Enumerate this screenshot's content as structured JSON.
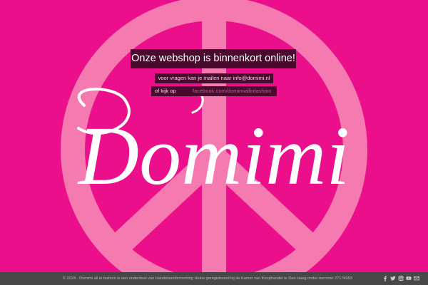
{
  "colors": {
    "background": "#ec0f8c",
    "peace_symbol": "#f47ab0",
    "banner_background": "#4a0a2d",
    "footer_background": "#474747"
  },
  "logo": {
    "text": "Domimi"
  },
  "announcement": {
    "headline": "Onze webshop is binnenkort online!",
    "contact_line": "voor vragen kan je mailen naar info@domimi.nl",
    "facebook_label": "of kijk op",
    "facebook_link": "facebook.com/domimiallinfashion"
  },
  "footer": {
    "text": "© 2024 · Domimi all in fashion is een onderdeel van Handelsonderneming Heine geregistreerd bij de Kamer van Koophandel te Den Haag onder nummer 27174053",
    "social_icons": [
      "facebook-icon",
      "twitter-icon",
      "instagram-icon",
      "youtube-icon",
      "mail-icon"
    ]
  }
}
